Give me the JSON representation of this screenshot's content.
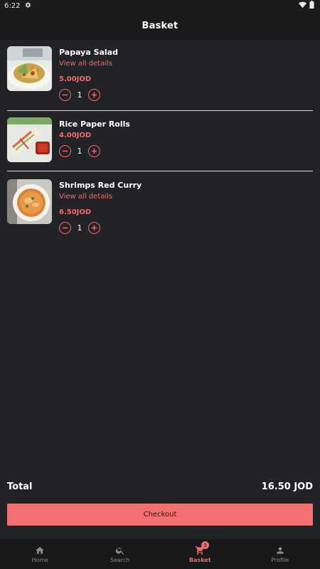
{
  "status_bar": {
    "time": "6:22",
    "icons": [
      "settings-gear-icon",
      "wifi-icon",
      "battery-icon"
    ]
  },
  "app_bar": {
    "title": "Basket"
  },
  "cart": {
    "items": [
      {
        "name": "Papaya Salad",
        "details_link": "View all details",
        "price": "5.00JOD",
        "quantity": "1",
        "image": "papaya-salad-photo"
      },
      {
        "name": "Rice Paper Rolls",
        "details_link": "",
        "price": "4.00JOD",
        "quantity": "1",
        "image": "rice-paper-rolls-photo"
      },
      {
        "name": "Shrimps Red Curry",
        "details_link": "View all details",
        "price": "6.50JOD",
        "quantity": "1",
        "image": "shrimps-red-curry-photo"
      }
    ]
  },
  "summary": {
    "total_label": "Total",
    "total_value": "16.50 JOD"
  },
  "checkout": {
    "label": "Checkout"
  },
  "bottom_nav": {
    "items": [
      {
        "label": "Home",
        "icon": "home-icon",
        "active": false
      },
      {
        "label": "Search",
        "icon": "search-icon",
        "active": false
      },
      {
        "label": "Basket",
        "icon": "cart-icon",
        "active": true,
        "badge": "3"
      },
      {
        "label": "Profile",
        "icon": "person-icon",
        "active": false
      }
    ]
  },
  "colors": {
    "background": "#222326",
    "bar": "#1a1b1d",
    "accent": "#f26a6a",
    "checkout": "#f47070",
    "text": "#ffffff",
    "nav_inactive": "#8a8a8a"
  }
}
